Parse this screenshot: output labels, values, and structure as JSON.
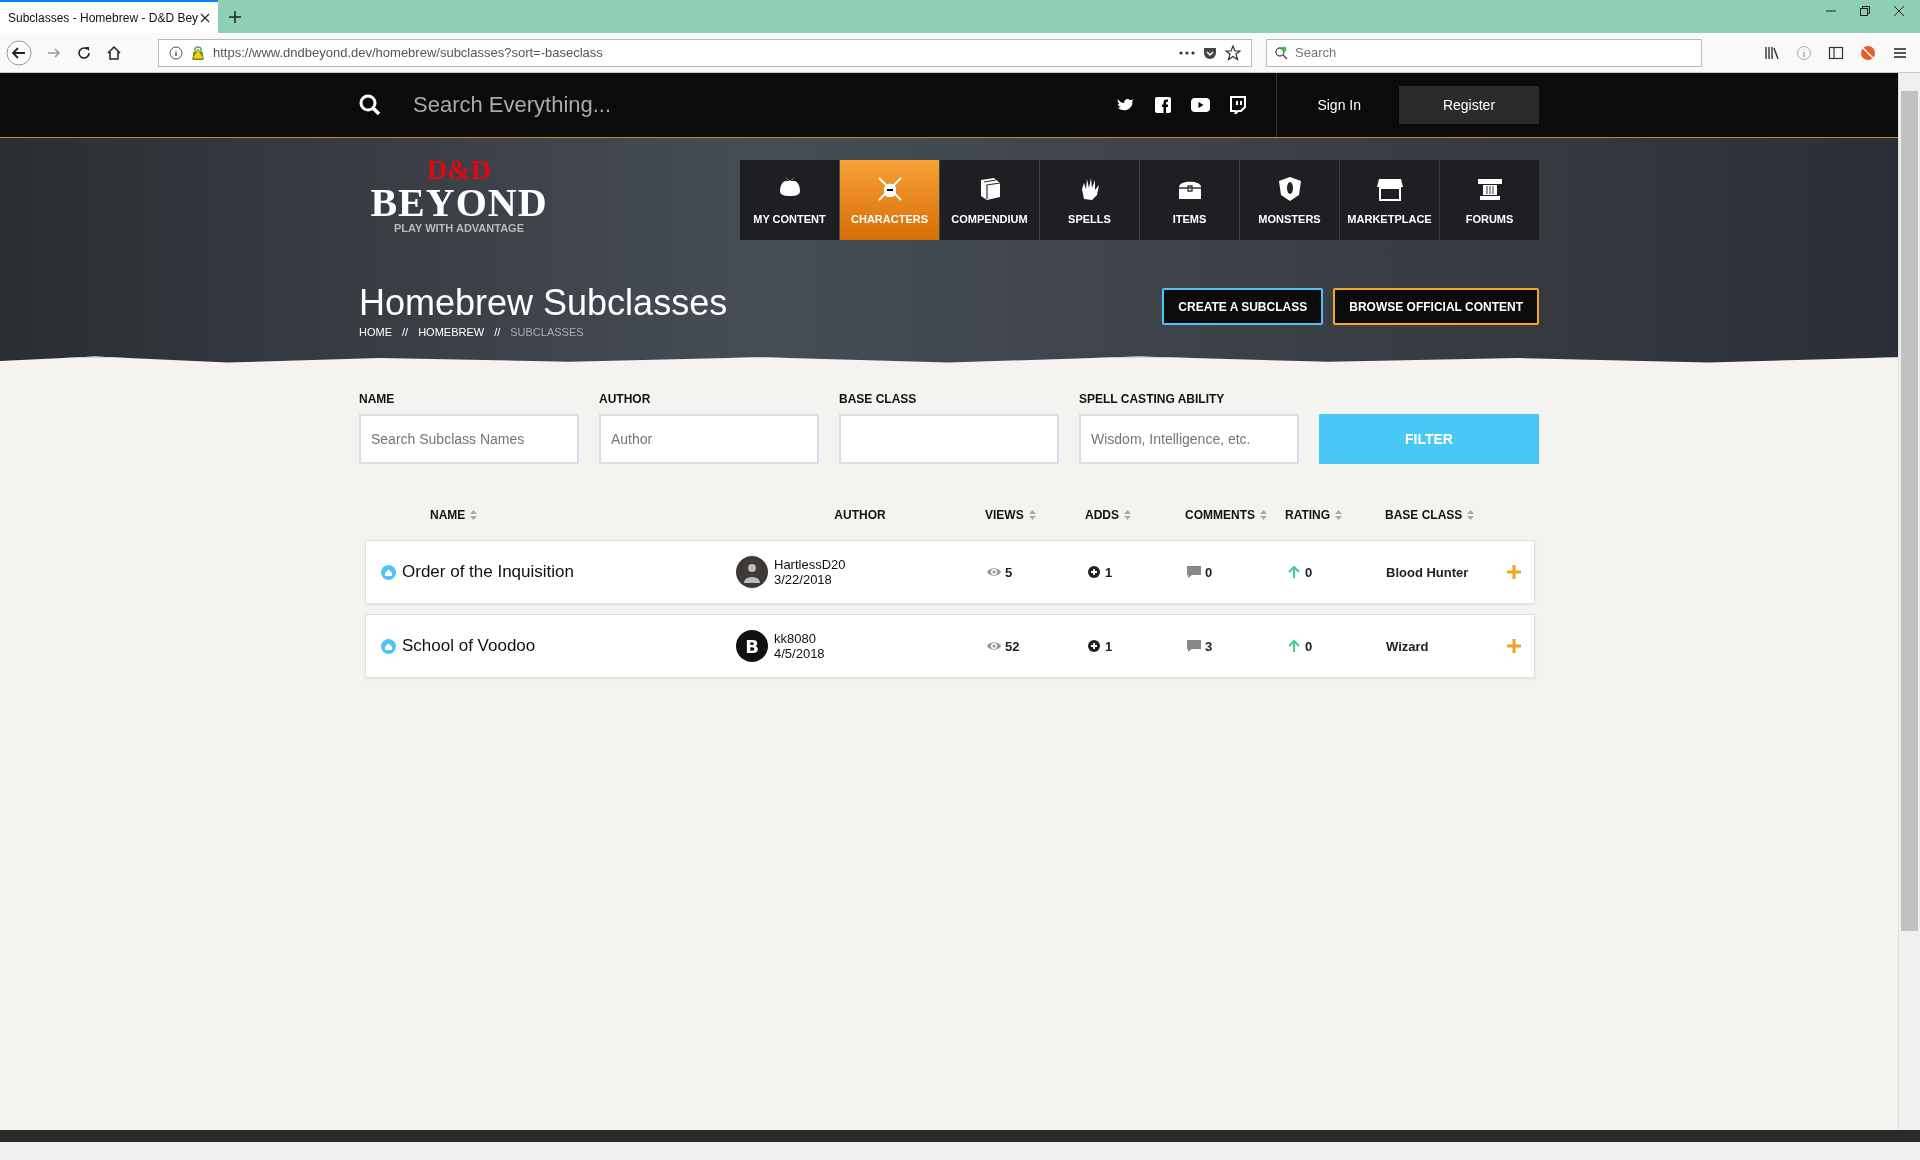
{
  "browser": {
    "tab": {
      "title": "Subclasses - Homebrew - D&D Bey",
      "selected": true
    },
    "url": "https://www.dndbeyond.dev/homebrew/subclasses?sort=-baseclass",
    "search_placeholder": "Search"
  },
  "site_header": {
    "search_placeholder": "Search Everything...",
    "sign_in": "Sign In",
    "register": "Register"
  },
  "logo": {
    "mark": "D&D",
    "name": "BEYOND",
    "tagline": "PLAY WITH ADVANTAGE"
  },
  "nav": [
    {
      "label": "MY CONTENT",
      "kind": "bag",
      "selected": false
    },
    {
      "label": "CHARACTERS",
      "kind": "helmet",
      "selected": true
    },
    {
      "label": "COMPENDIUM",
      "kind": "book",
      "selected": false
    },
    {
      "label": "SPELLS",
      "kind": "hand",
      "selected": false
    },
    {
      "label": "ITEMS",
      "kind": "chest",
      "selected": false
    },
    {
      "label": "MONSTERS",
      "kind": "eye",
      "selected": false
    },
    {
      "label": "MARKETPLACE",
      "kind": "shop",
      "selected": false
    },
    {
      "label": "FORUMS",
      "kind": "pillar",
      "selected": false
    }
  ],
  "hero": {
    "title": "Homebrew Subclasses",
    "breadcrumbs": [
      {
        "label": "HOME",
        "current": false
      },
      {
        "label": "HOMEBREW",
        "current": false
      },
      {
        "label": "SUBCLASSES",
        "current": true
      }
    ],
    "separator": "//",
    "buttons": [
      {
        "label": "CREATE A SUBCLASS",
        "color": "#4fc3f7"
      },
      {
        "label": "BROWSE OFFICIAL CONTENT",
        "color": "#f5a623"
      }
    ]
  },
  "filters": {
    "fields": [
      {
        "label": "NAME",
        "placeholder": "Search Subclass Names"
      },
      {
        "label": "AUTHOR",
        "placeholder": "Author"
      },
      {
        "label": "BASE CLASS"
      },
      {
        "label": "SPELL CASTING ABILITY",
        "placeholder": "Wisdom, Intelligence, etc."
      }
    ],
    "button": "FILTER"
  },
  "table": {
    "columns": [
      {
        "label": "NAME",
        "sortable": true
      },
      {
        "label": "AUTHOR",
        "sortable": false
      },
      {
        "label": "VIEWS",
        "sortable": true
      },
      {
        "label": "ADDS",
        "sortable": true
      },
      {
        "label": "COMMENTS",
        "sortable": true
      },
      {
        "label": "RATING",
        "sortable": true
      },
      {
        "label": "BASE CLASS",
        "sortable": true
      }
    ],
    "rows": [
      {
        "name": "Order of the Inquisition",
        "author": "HartlessD20",
        "date": "3/22/2018",
        "views": "5",
        "adds": "1",
        "comments": "0",
        "rating": "0",
        "base_class": "Blood Hunter",
        "avatar": {
          "kind": "photo"
        }
      },
      {
        "name": "School of Voodoo",
        "author": "kk8080",
        "date": "4/5/2018",
        "views": "52",
        "adds": "1",
        "comments": "3",
        "rating": "0",
        "base_class": "Wizard",
        "avatar": {
          "kind": "letter",
          "text": "B"
        }
      }
    ]
  }
}
